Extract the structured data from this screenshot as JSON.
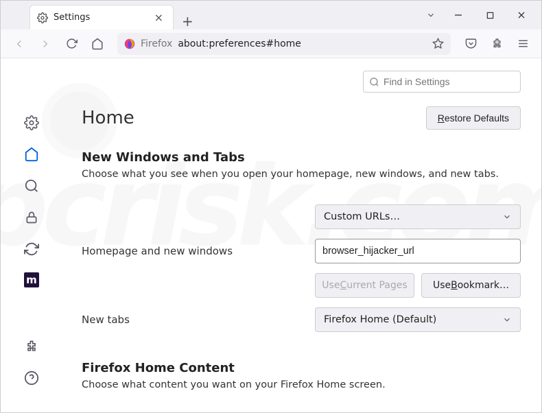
{
  "tab": {
    "title": "Settings"
  },
  "url": {
    "scope": "Firefox",
    "path": "about:preferences#home"
  },
  "search": {
    "placeholder": "Find in Settings"
  },
  "page": {
    "title": "Home",
    "restore": "Restore Defaults",
    "section1": {
      "title": "New Windows and Tabs",
      "desc": "Choose what you see when you open your homepage, new windows, and new tabs."
    },
    "homepage_dropdown": "Custom URLs…",
    "homepage_label": "Homepage and new windows",
    "homepage_url": "browser_hijacker_url",
    "use_current": "Use Current Pages",
    "use_bookmark": "Use Bookmark…",
    "newtabs_label": "New tabs",
    "newtabs_dropdown": "Firefox Home (Default)",
    "section2": {
      "title": "Firefox Home Content",
      "desc": "Choose what content you want on your Firefox Home screen."
    }
  }
}
